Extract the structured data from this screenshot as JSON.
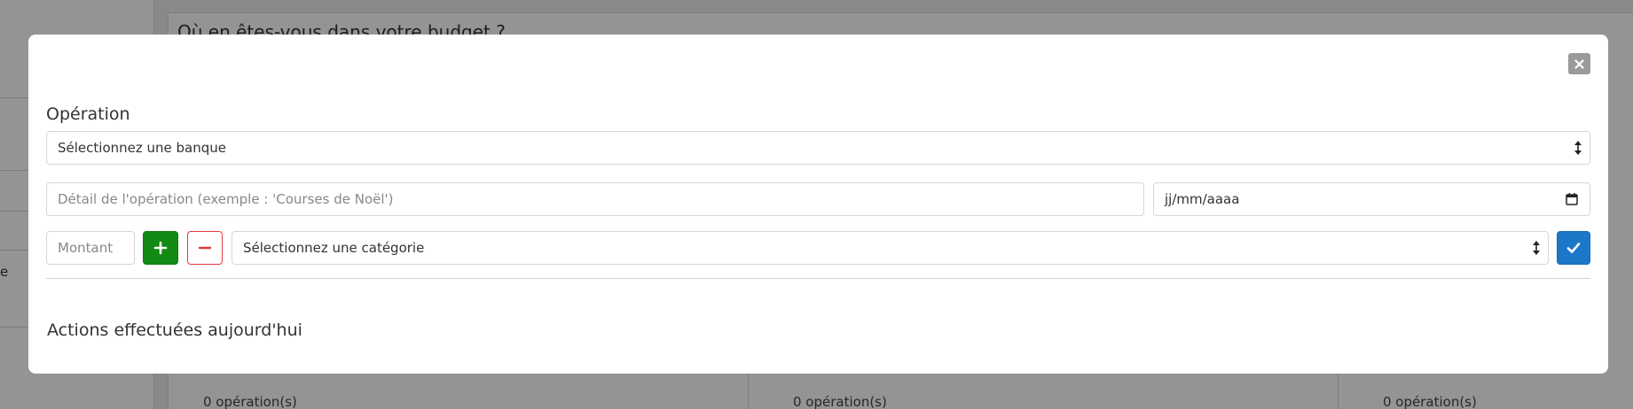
{
  "background": {
    "question": "Où en êtes-vous dans votre budget ?",
    "sidebar_fragment": "e",
    "operations_count_label": "0 opération(s)"
  },
  "modal": {
    "title": "Opération",
    "bank_select": {
      "selected": "Sélectionnez une banque"
    },
    "detail_input": {
      "placeholder": "Détail de l'opération (exemple : 'Courses de Noël')",
      "value": ""
    },
    "date_input": {
      "placeholder": "jj/mm/aaaa"
    },
    "amount_input": {
      "placeholder": "Montant"
    },
    "category_select": {
      "selected": "Sélectionnez une catégorie"
    },
    "actions_title": "Actions effectuées aujourd'hui"
  },
  "icons": {
    "close": "close-icon",
    "plus": "plus-icon",
    "minus": "minus-icon",
    "check": "check-icon",
    "calendar": "calendar-icon",
    "select_arrows": "select-updown-icon"
  },
  "colors": {
    "plus_button": "#138a13",
    "minus_border": "#e03a3a",
    "submit_button": "#1b78c9",
    "close_button": "#9a9a9a",
    "overlay": "rgba(0,0,0,0.42)"
  }
}
